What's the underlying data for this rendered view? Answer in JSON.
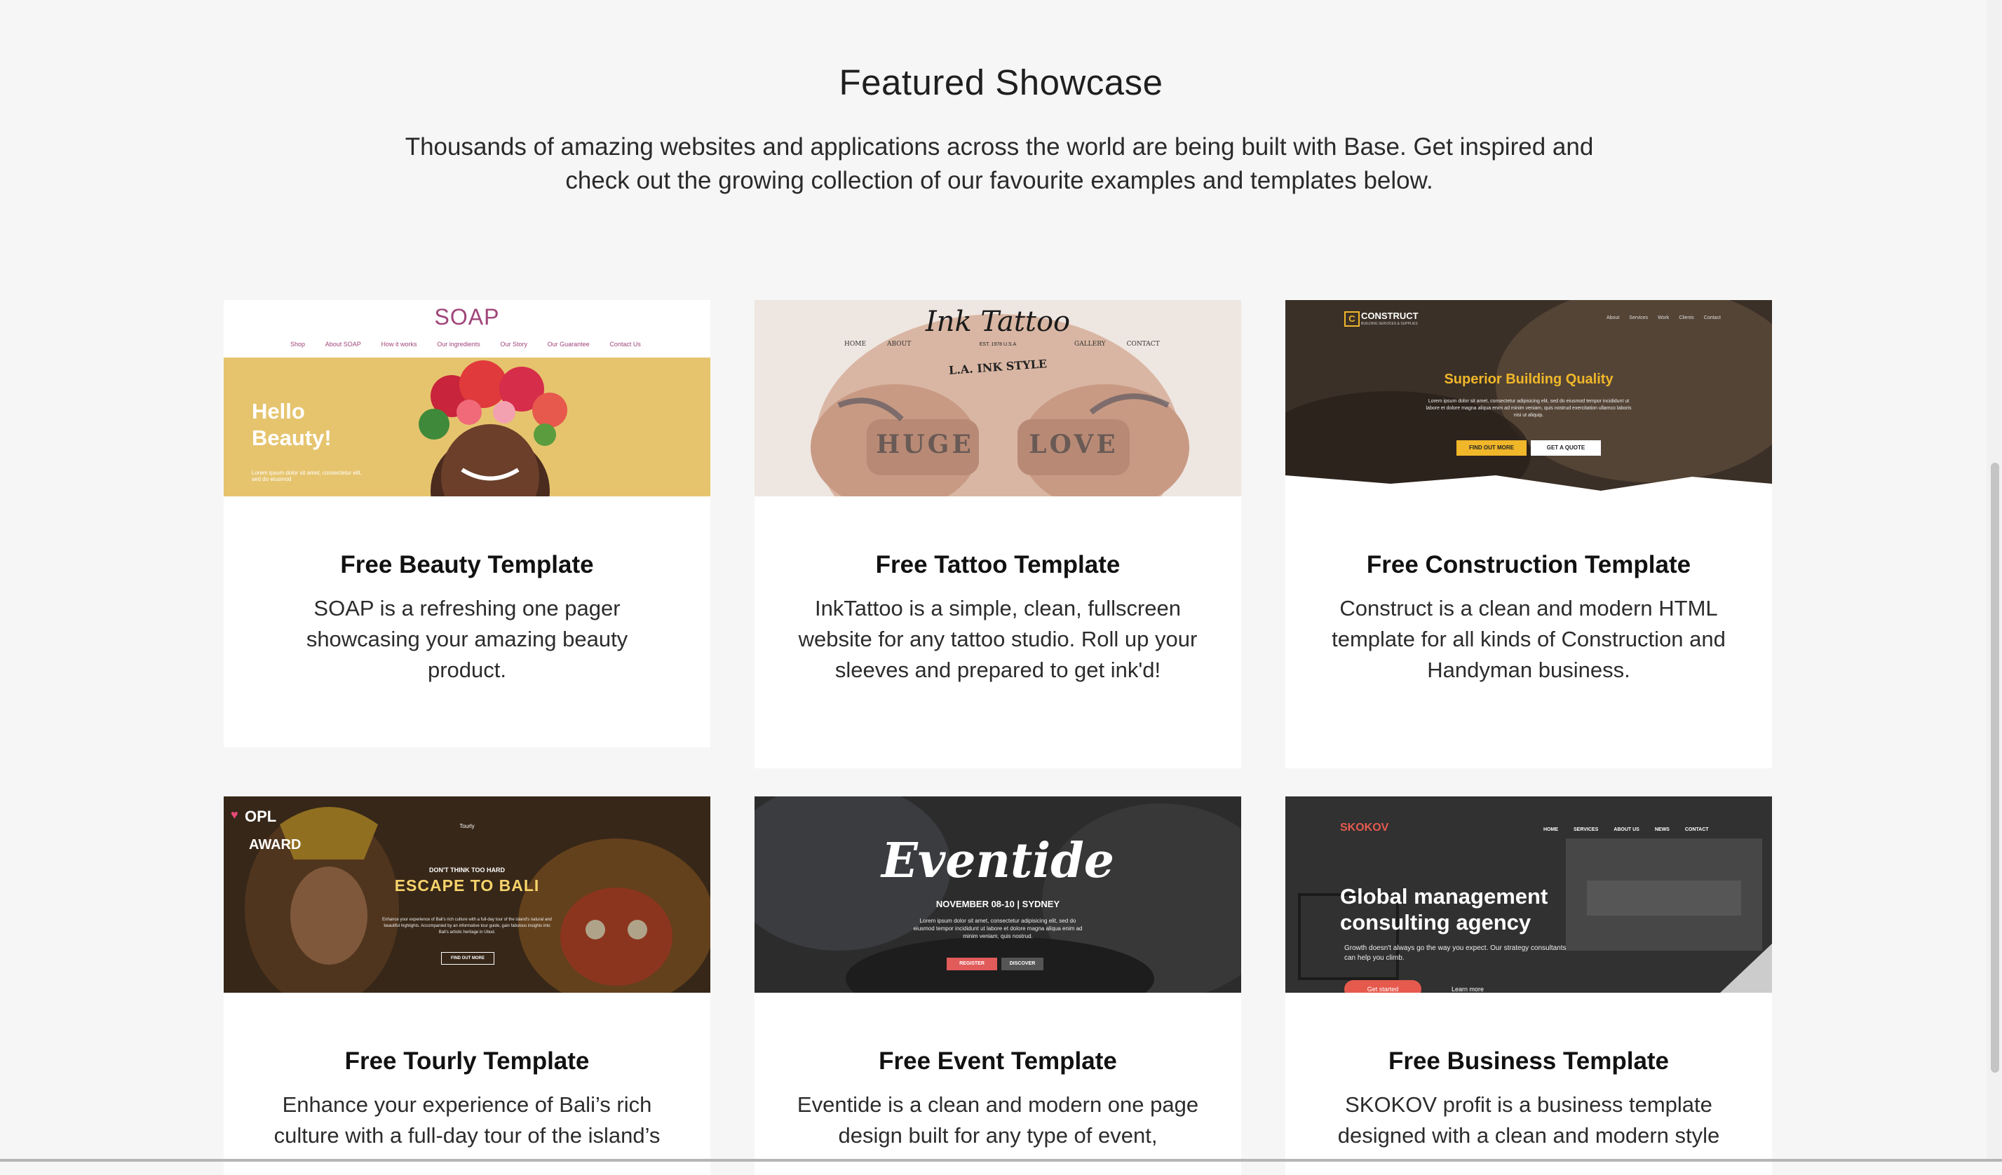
{
  "section": {
    "title": "Featured Showcase",
    "lead": "Thousands of amazing websites and applications across the world are being built with Base. Get inspired and check out the growing collection of our favourite examples and templates below."
  },
  "cards": [
    {
      "title": "Free Beauty Template",
      "text": "SOAP is a refreshing one pager showcasing your amazing beauty product.",
      "thumb": {
        "logo": "SOAP",
        "nav": [
          "Shop",
          "About SOAP",
          "How it works",
          "Our ingredients",
          "Our Story",
          "Our Guarantee",
          "Contact Us"
        ],
        "headline": "Hello Beauty!",
        "sub": "Lorem ipsum dolor sit amet, consectetur elit, sed do eiusmod"
      }
    },
    {
      "title": "Free Tattoo Template",
      "text": "InkTattoo is a simple, clean, fullscreen website for any tattoo studio. Roll up your sleeves and prepared to get ink'd!",
      "thumb": {
        "logo": "Ink Tattoo",
        "tagline": "EST. 1978 U.S.A",
        "headline": "L.A. INK STYLE",
        "nav_left": [
          "HOME",
          "ABOUT"
        ],
        "nav_right": [
          "GALLERY",
          "CONTACT"
        ],
        "knuckles": [
          "HUGE",
          "LOVE"
        ]
      }
    },
    {
      "title": "Free Construction Template",
      "text": "Construct is a clean and modern HTML template for all kinds of Construction and Handyman business.",
      "thumb": {
        "logo": "CONSTRUCT",
        "logo_mark": "C",
        "logo_sub": "BUILDING SERVICES & SUPPLIES",
        "nav": [
          "About",
          "Services",
          "Work",
          "Clients",
          "Contact"
        ],
        "headline": "Superior Building Quality",
        "sub": "Lorem ipsum dolor sit amet, consectetur adipisicing elit, sed do eiusmod tempor incididunt ut labore et dolore magna aliqua enim ad minim veniam, quis nostrud exercitation ullamco laboris nisi ut aliquip.",
        "btn1": "FIND OUT MORE",
        "btn2": "GET A QUOTE"
      }
    },
    {
      "title": "Free Tourly Template",
      "text": "Enhance your experience of Bali’s rich culture with a full-day tour of the island’s",
      "thumb": {
        "badge1": "OPL",
        "badge2": "AWARD",
        "brand": "Tourly",
        "kicker": "DON'T THINK TOO HARD",
        "headline": "ESCAPE TO BALI",
        "sub": "Enhance your experience of Bali's rich culture with a full-day tour of the island's natural and beautiful highlights. Accompanied by an informative tour guide, gain fabulous insights into Bali's artistic heritage in Ubud.",
        "btn": "FIND OUT MORE"
      }
    },
    {
      "title": "Free Event Template",
      "text": "Eventide is a clean and modern one page design built for any type of event,",
      "thumb": {
        "logo": "Eventide",
        "date": "NOVEMBER 08-10 | SYDNEY",
        "sub": "Lorem ipsum dolor sit amet, consectetur adipisicing elit, sed do eiusmod tempor incididunt ut labore et dolore magna aliqua enim ad minim veniam, quis nostrud.",
        "btn1": "REGISTER",
        "btn2": "DISCOVER"
      }
    },
    {
      "title": "Free Business Template",
      "text": "SKOKOV profit is a business template designed with a clean and modern style",
      "thumb": {
        "logo": "SKOKOV",
        "nav": [
          "HOME",
          "SERVICES",
          "ABOUT US",
          "NEWS",
          "CONTACT"
        ],
        "headline": "Global management consulting agency",
        "sub": "Growth doesn't always go the way you expect. Our strategy consultants can help you climb.",
        "btn1": "Get started",
        "btn2": "Learn more"
      }
    }
  ]
}
